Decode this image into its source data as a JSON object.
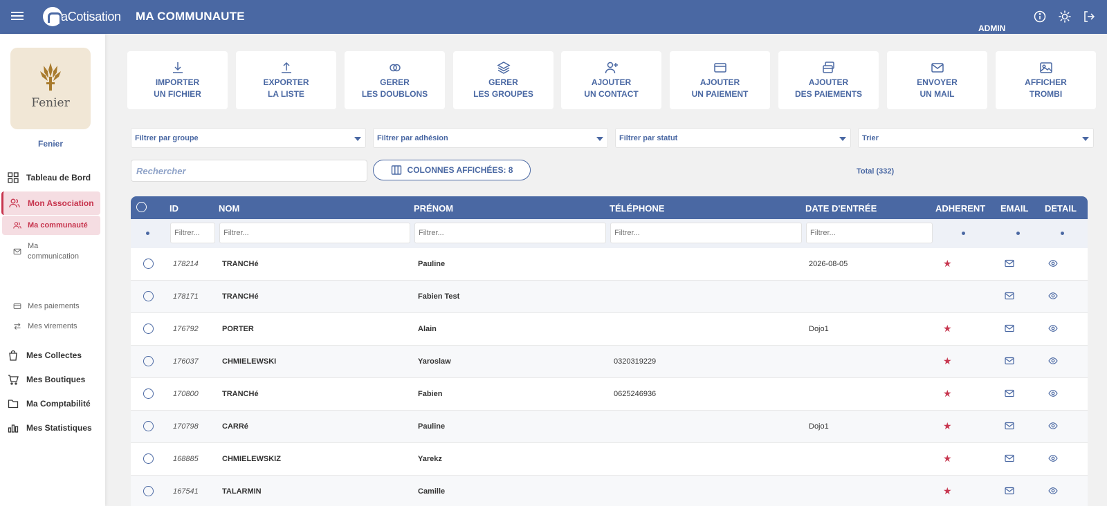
{
  "header": {
    "logo_text": "aCotisation",
    "page_title": "MA COMMUNAUTE",
    "user_role": "ADMIN"
  },
  "org": {
    "logo_text": "Fenier",
    "name": "Fenier"
  },
  "nav": {
    "dashboard": "Tableau de Bord",
    "association": "Mon Association",
    "community": "Ma communauté",
    "communication": "Ma communication",
    "payments": "Mes paiements",
    "transfers": "Mes virements",
    "collections": "Mes Collectes",
    "shops": "Mes Boutiques",
    "accounting": "Ma Comptabilité",
    "stats": "Mes Statistiques"
  },
  "actions": [
    {
      "l1": "IMPORTER",
      "l2": "UN FICHIER",
      "icon": "download-icon"
    },
    {
      "l1": "EXPORTER",
      "l2": "LA LISTE",
      "icon": "upload-icon"
    },
    {
      "l1": "GERER",
      "l2": "LES DOUBLONS",
      "icon": "duplicates-icon"
    },
    {
      "l1": "GERER",
      "l2": "LES GROUPES",
      "icon": "layers-icon"
    },
    {
      "l1": "AJOUTER",
      "l2": "UN CONTACT",
      "icon": "add-user-icon"
    },
    {
      "l1": "AJOUTER",
      "l2": "UN PAIEMENT",
      "icon": "credit-card-icon"
    },
    {
      "l1": "AJOUTER",
      "l2": "DES PAIEMENTS",
      "icon": "cards-icon"
    },
    {
      "l1": "ENVOYER",
      "l2": "UN MAIL",
      "icon": "mail-icon"
    },
    {
      "l1": "AFFICHER",
      "l2": "TROMBI",
      "icon": "image-icon"
    }
  ],
  "filters": {
    "group": "Filtrer par groupe",
    "membership": "Filtrer par adhésion",
    "status": "Filtrer par statut",
    "sort": "Trier"
  },
  "search": {
    "placeholder": "Rechercher"
  },
  "columns_button": "COLONNES AFFICHÉES: 8",
  "total": "Total (332)",
  "table": {
    "headers": {
      "id": "ID",
      "nom": "NOM",
      "prenom": "PRÉNOM",
      "telephone": "TÉLÉPHONE",
      "date": "DATE D'ENTRÉE",
      "adherent": "ADHERENT",
      "email": "EMAIL",
      "detail": "DETAIL"
    },
    "filter_placeholder": "Filtrer...",
    "rows": [
      {
        "id": "178214",
        "nom": "TRANCHé",
        "prenom": "Pauline",
        "tel": "",
        "date": "2026-08-05",
        "adherent": true
      },
      {
        "id": "178171",
        "nom": "TRANCHé",
        "prenom": "Fabien Test",
        "tel": "",
        "date": "",
        "adherent": false
      },
      {
        "id": "176792",
        "nom": "PORTER",
        "prenom": "Alain",
        "tel": "",
        "date": "Dojo1",
        "adherent": true
      },
      {
        "id": "176037",
        "nom": "CHMIELEWSKI",
        "prenom": "Yaroslaw",
        "tel": "0320319229",
        "date": "",
        "adherent": true
      },
      {
        "id": "170800",
        "nom": "TRANCHé",
        "prenom": "Fabien",
        "tel": "0625246936",
        "date": "",
        "adherent": true
      },
      {
        "id": "170798",
        "nom": "CARRé",
        "prenom": "Pauline",
        "tel": "",
        "date": "Dojo1",
        "adherent": true
      },
      {
        "id": "168885",
        "nom": "CHMIELEWSKIZ",
        "prenom": "Yarekz",
        "tel": "",
        "date": "",
        "adherent": true
      },
      {
        "id": "167541",
        "nom": "TALARMIN",
        "prenom": "Camille",
        "tel": "",
        "date": "",
        "adherent": true
      }
    ]
  },
  "colors": {
    "primary": "#4a68a3",
    "accent": "#c7354e",
    "active_bg": "#f5dde2"
  }
}
